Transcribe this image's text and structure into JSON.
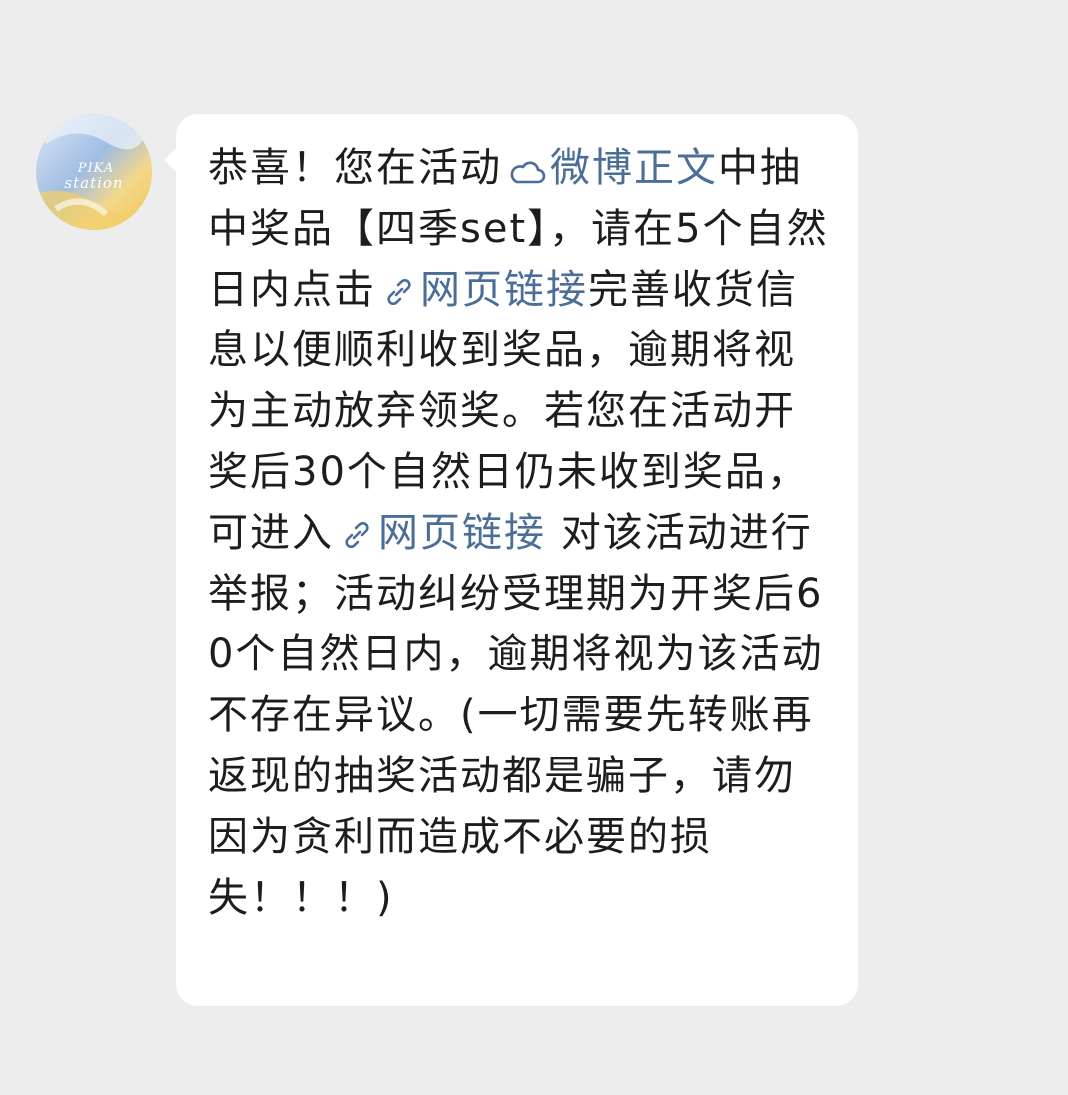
{
  "avatar": {
    "logo_text_top": "PIKA",
    "logo_text_bottom": "station"
  },
  "message": {
    "segments": [
      "恭喜！您在活动",
      "微博正文",
      "中抽中奖品【四季set】，请在5个自然日内点击",
      "网页链接",
      "完善收货信息以便顺利收到奖品，逾期将视为主动放弃领奖。若您在活动开奖后30个自然日仍未收到奖品，可进入",
      "网页链接",
      " 对该活动进行举报；活动纠纷受理期为开奖后60个自然日内，逾期将视为该活动不存在异议。(一切需要先转账再返现的抽奖活动都是骗子，请勿因为贪利而造成不必要的损失！！！)"
    ],
    "link_color": "#4b6e99",
    "text_color": "#1d1d1d"
  },
  "icons": {
    "weibo_link": "cloud-icon",
    "web_link": "chain-link-icon"
  }
}
